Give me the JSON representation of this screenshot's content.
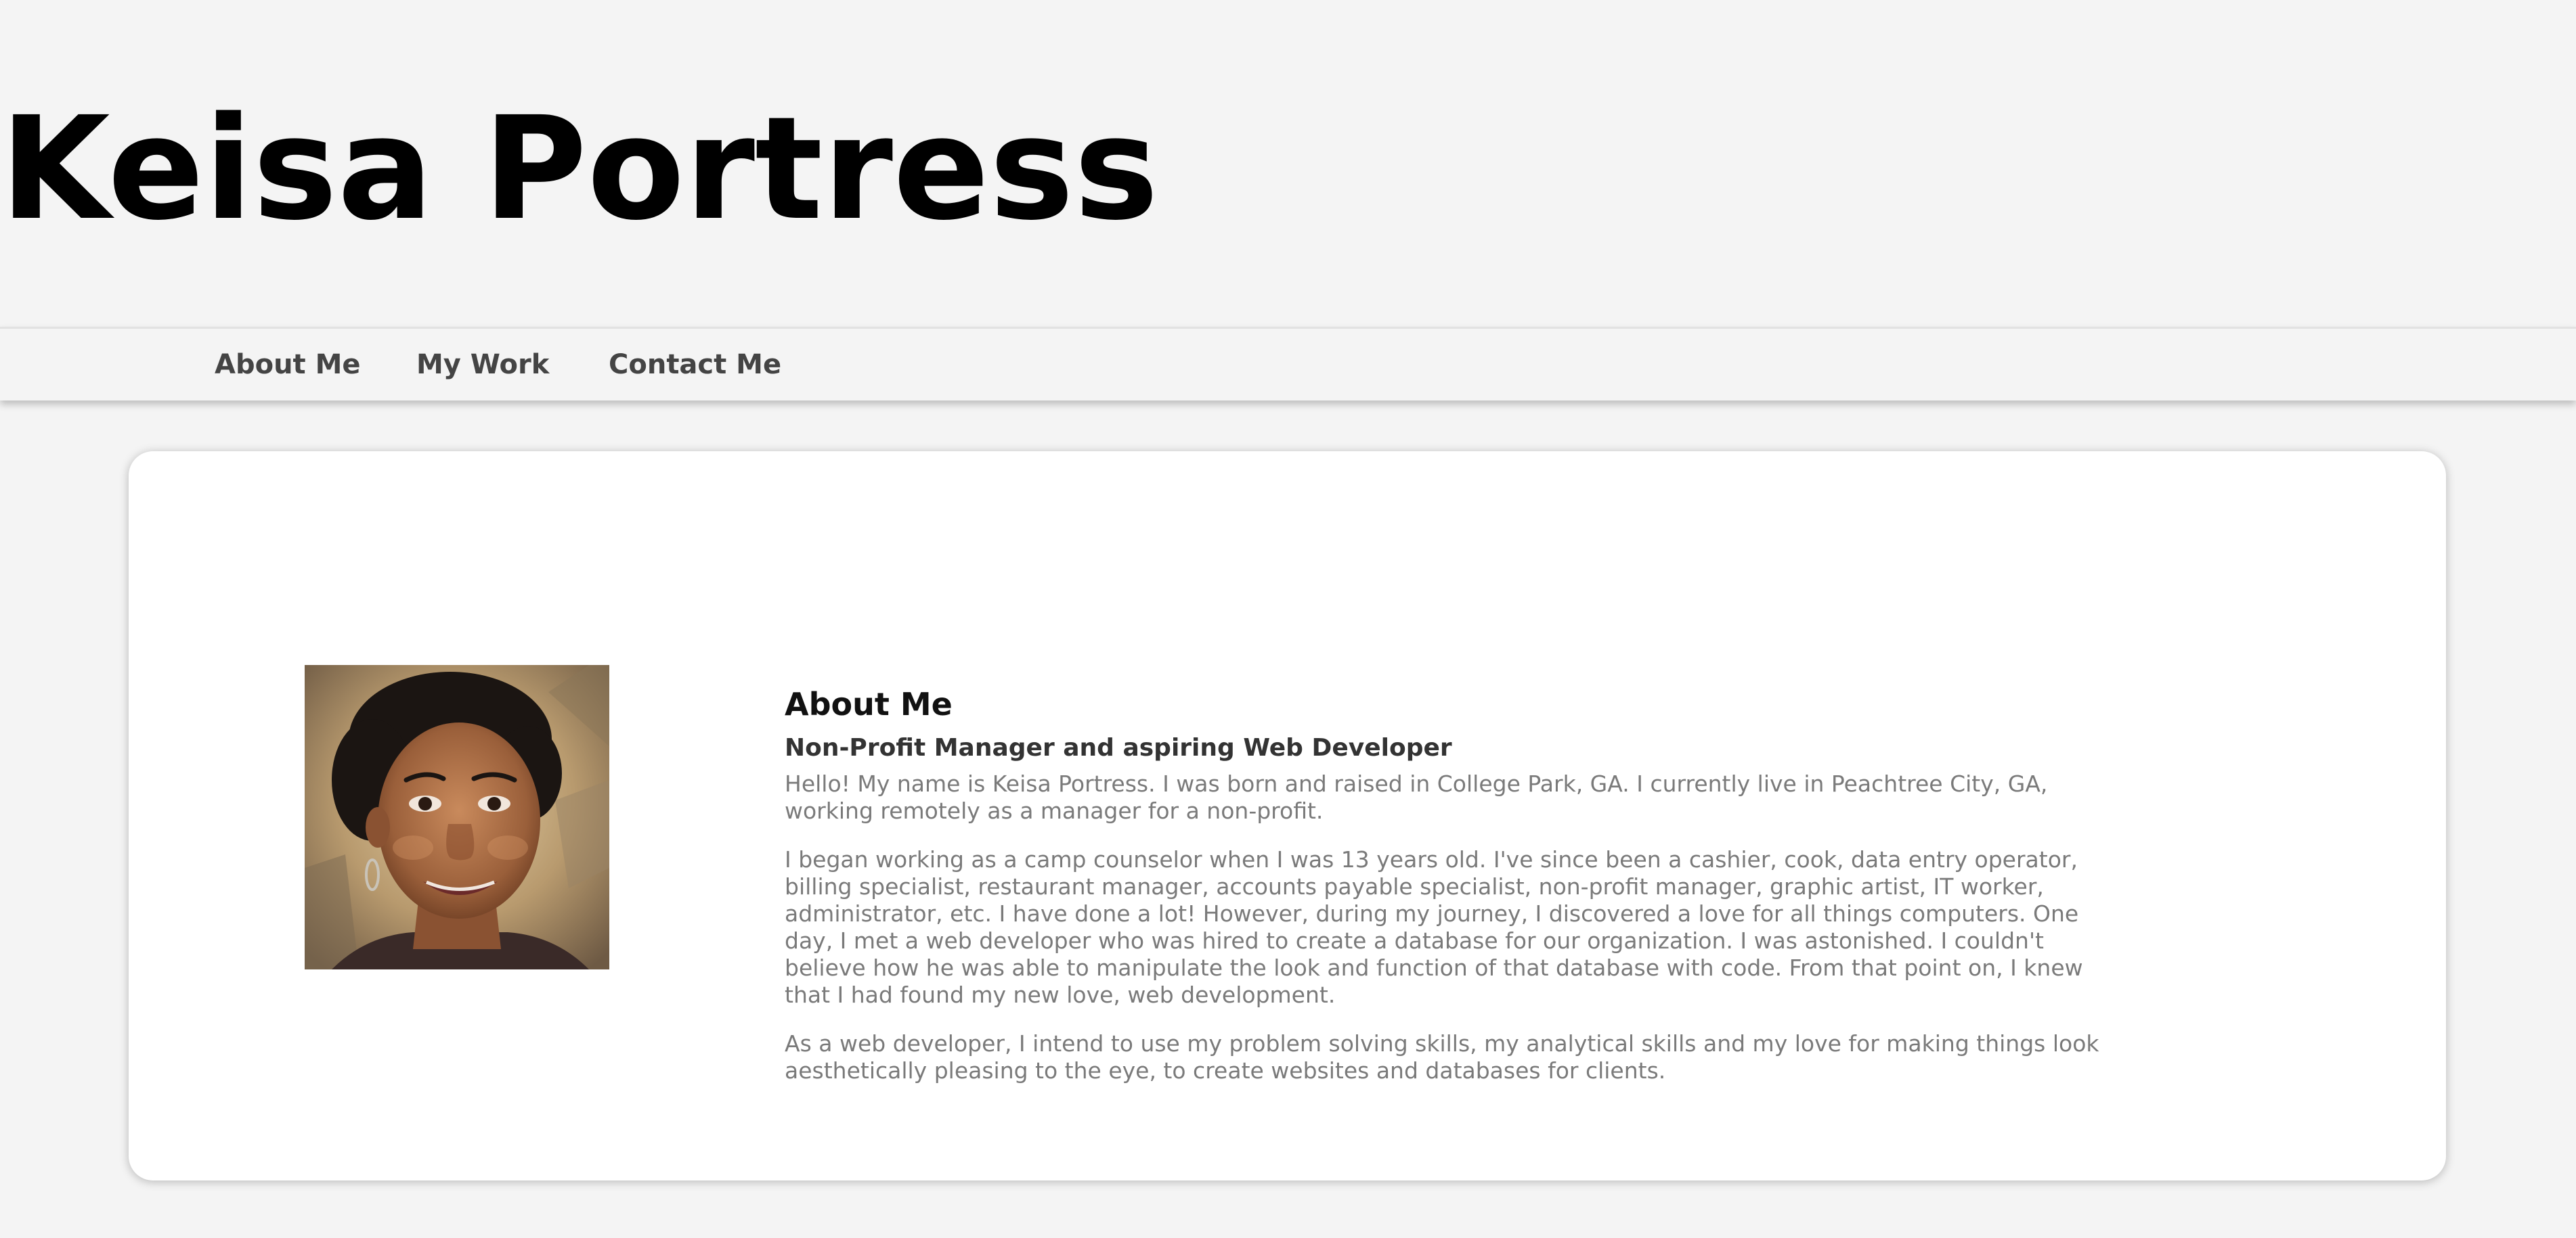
{
  "header": {
    "title": "Keisa Portress"
  },
  "nav": {
    "items": [
      {
        "label": "About Me"
      },
      {
        "label": "My Work"
      },
      {
        "label": "Contact Me"
      }
    ]
  },
  "about": {
    "heading": "About Me",
    "subtitle": "Non-Profit Manager and aspiring Web Developer",
    "paragraphs": [
      "Hello! My name is Keisa Portress. I was born and raised in College Park, GA. I currently live in Peachtree City, GA, working remotely as a manager for a non-profit.",
      "I began working as a camp counselor when I was 13 years old. I've since been a cashier, cook, data entry operator, billing specialist, restaurant manager, accounts payable specialist, non-profit manager, graphic artist, IT worker, administrator, etc. I have done a lot! However, during my journey, I discovered a love for all things computers. One day, I met a web developer who was hired to create a database for our organization. I was astonished. I couldn't believe how he was able to manipulate the look and function of that database with code. From that point on, I knew that I had found my new love, web development.",
      "As a web developer, I intend to use my problem solving skills, my analytical skills and my love for making things look aesthetically pleasing to the eye, to create websites and databases for clients."
    ]
  }
}
